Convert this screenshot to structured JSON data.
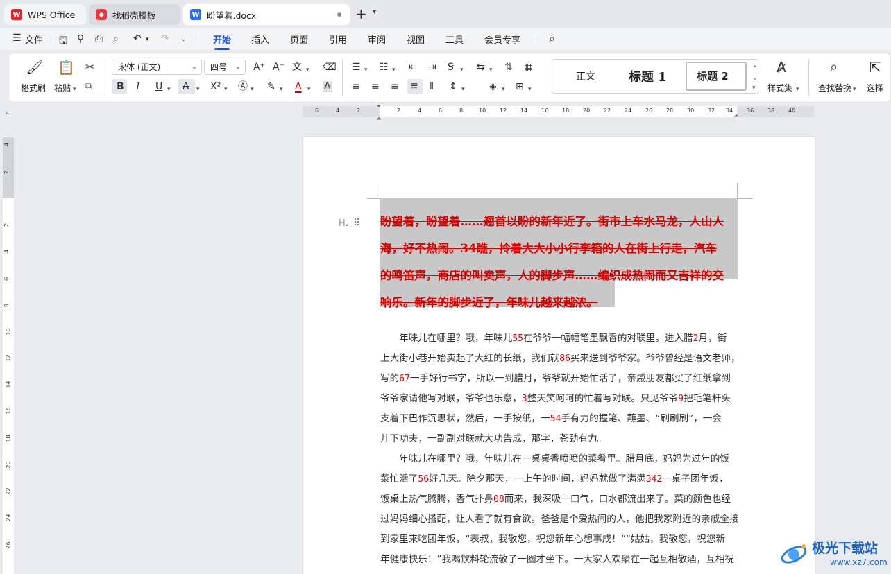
{
  "tabs": {
    "wps": "WPS Office",
    "daoke": "找稻壳模板",
    "doc": "盼望着.docx",
    "add": "+",
    "more": "⌄"
  },
  "menu": {
    "file": "文件",
    "items": [
      "开始",
      "插入",
      "页面",
      "引用",
      "审阅",
      "视图",
      "工具",
      "会员专享"
    ],
    "active": "开始"
  },
  "ribbon": {
    "format_painter": "格式刷",
    "paste": "粘贴",
    "font_name": "宋体 (正文)",
    "font_size": "四号",
    "bold": "B",
    "italic": "I",
    "underline": "U",
    "strike": "A",
    "superscript": "X²",
    "styles": {
      "normal": "正文",
      "heading1": "标题 1",
      "heading2": "标题 2"
    },
    "styles_set": "样式集",
    "find_replace": "查找替换",
    "select": "选择"
  },
  "ruler": {
    "h_left": [
      "6",
      "4",
      "2"
    ],
    "h_right": [
      "2",
      "4",
      "6",
      "8",
      "10",
      "12",
      "14",
      "16",
      "18",
      "20",
      "22",
      "24",
      "26",
      "28",
      "30",
      "32",
      "34",
      "36",
      "38",
      "40"
    ],
    "v_top": [
      "4",
      "2"
    ],
    "v": [
      "2",
      "4",
      "6",
      "8",
      "10",
      "12",
      "14",
      "16",
      "18",
      "20",
      "22",
      "24",
      "26"
    ]
  },
  "doc": {
    "h2_marker": "H₂",
    "heading_lines": [
      "盼望着，盼望着……翘首以盼的新年近了。街市上车水马龙，人山人",
      "海，好不热闹。34瞧，拎着大大小小行李箱的人在街上行走，汽车",
      "的鸣笛声，商店的叫卖声，人的脚步声……编织成热闹而又吉祥的交",
      "响乐。新年的脚步近了，年味儿越来越浓。"
    ],
    "para1": [
      [
        "　　年味儿在哪里？哦，年味儿",
        "55",
        "在爷爷一幅幅笔墨飘香的对联里。进入腊",
        "2",
        "月，街"
      ],
      [
        "上大街小巷开始卖起了大红的长纸，我们就",
        "86",
        "买来送到爷爷家。爷爷曾经是语文老师，"
      ],
      [
        "写的",
        "67",
        "一手好行书字，所以一到腊月，爷爷就开始忙活了，亲戚朋友都买了红纸拿到"
      ],
      [
        "爷爷家请他写对联，爷爷也乐意，",
        "3",
        "整天笑呵呵的忙着写对联。只见爷爷",
        "9",
        "把毛笔杆头"
      ],
      [
        "支着下巴作沉思状，然后，一手按纸，一",
        "54",
        "手有力的握笔、蘸墨、“刷刷刷”，一会"
      ],
      [
        "儿下功夫，一副副对联就大功告成，那字，苍劲有力。"
      ]
    ],
    "para2": [
      [
        "　　年味儿在哪里？哦，年味儿在一桌桌香喷喷的菜肴里。腊月底，妈妈为过年的饭"
      ],
      [
        "菜忙活了",
        "56",
        "好几天。除夕那天，一上午的时间，妈妈就做了满满",
        "342",
        "一桌子团年饭，"
      ],
      [
        "饭桌上热气腾腾，香气扑鼻",
        "08",
        "而来，我深吸一口气，口水都流出来了。菜的颜色也经"
      ],
      [
        "过妈妈细心搭配，让人看了就有食欲。爸爸是个爱热闹的人，他把我家附近的亲戚全接"
      ],
      [
        "到家里来吃团年饭，“表叔，我敬您，祝您新年心想事成！”“姑姑，我敬您，祝您新"
      ],
      [
        "年健康快乐！”我喝饮料轮流敬了一圈才坐下。一大家人欢聚在一起互相敬酒，互相祝"
      ]
    ]
  },
  "watermark": {
    "title": "极光下载站",
    "url": "www.xz7.com"
  },
  "colors": {
    "accent": "#1a56e6",
    "heading_red": "#e00000",
    "highlight": "#c8c8c8"
  }
}
